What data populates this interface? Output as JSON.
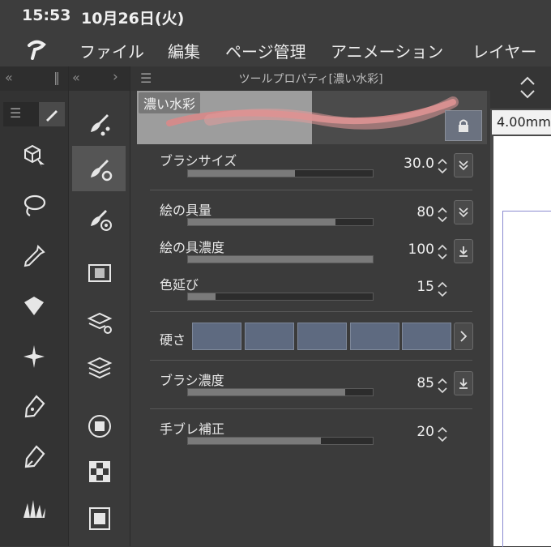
{
  "status": {
    "time": "15:53",
    "date": "10月26日(火)"
  },
  "menu": {
    "items": [
      "ファイル",
      "編集",
      "ページ管理",
      "アニメーション",
      "レイヤー"
    ]
  },
  "panel": {
    "title": "ツールプロパティ[濃い水彩]",
    "preset_name": "濃い水彩",
    "zoom_readout": "4.00mm",
    "rows": [
      {
        "label": "ブラシサイズ",
        "value": "30.0",
        "level": 0.58
      },
      {
        "label": "絵の具量",
        "value": "80",
        "level": 0.8
      },
      {
        "label": "絵の具濃度",
        "value": "100",
        "level": 1.0
      },
      {
        "label": "色延び",
        "value": "15",
        "level": 0.15
      },
      {
        "label": "ブラシ濃度",
        "value": "85",
        "level": 0.85
      },
      {
        "label": "手ブレ補正",
        "value": "20",
        "level": 0.72
      }
    ],
    "hardness_label": "硬さ"
  },
  "colors": {
    "accent": "#5e6a80",
    "stroke": "#d98a8a"
  }
}
